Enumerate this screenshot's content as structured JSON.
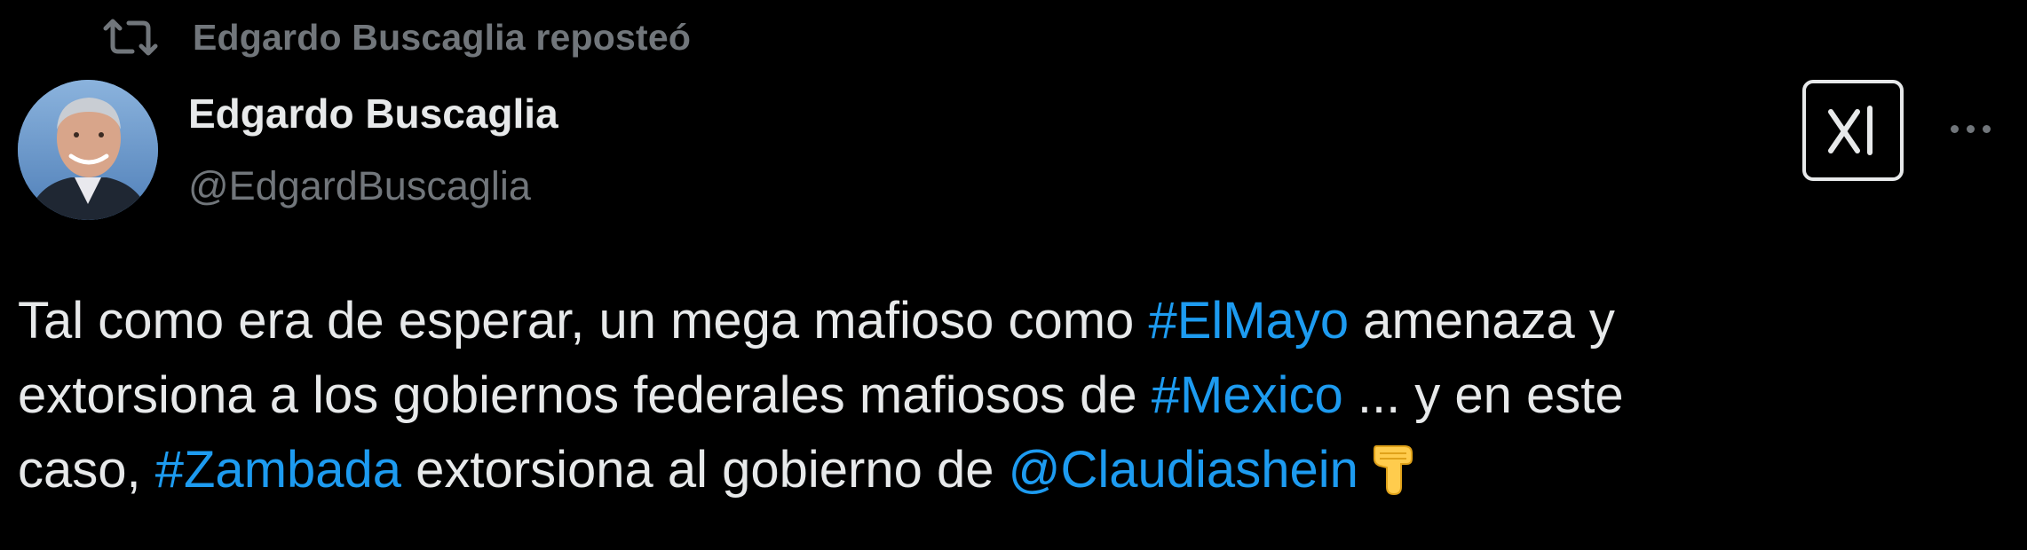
{
  "repost": {
    "icon": "repost-icon",
    "text": "Edgardo Buscaglia reposteó"
  },
  "author": {
    "avatar_icon": "avatar",
    "name": "Edgardo Buscaglia",
    "handle": "@EdgardBuscaglia"
  },
  "actions": {
    "grok_icon": "grok-icon",
    "more_icon": "more-icon"
  },
  "tweet": {
    "line1": {
      "before": "Tal como era de esperar, un mega mafioso como ",
      "hashtag": "#ElMayo",
      "after": " amenaza y"
    },
    "line2": {
      "before": "extorsiona a los gobiernos federales mafiosos de ",
      "hashtag": "#Mexico",
      "after": " ... y en este"
    },
    "line3": {
      "before": "caso, ",
      "hashtag": "#Zambada",
      "middle": " extorsiona al gobierno de ",
      "mention": "@Claudiashein",
      "emoji": "pointing-down-hand-emoji"
    }
  },
  "colors": {
    "background": "#000000",
    "text": "#e7e9ea",
    "secondary": "#71767b",
    "link": "#1d9bf0"
  }
}
